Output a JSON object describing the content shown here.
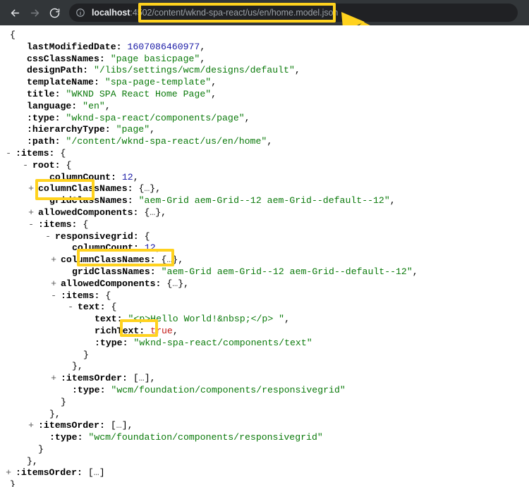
{
  "browser": {
    "back_icon": "back-arrow-icon",
    "forward_icon": "forward-arrow-icon",
    "reload_icon": "reload-icon",
    "site_info_icon": "info-circle-icon",
    "url_host": "localhost",
    "url_port": ":4502",
    "url_path": "/content/wknd-spa-react/us/en/home.model.json",
    "url_full": "localhost:4502/content/wknd-spa-react/us/en/home.model.json",
    "toolbar_bg": "#323639",
    "omnibox_bg": "#202124"
  },
  "annotation": {
    "highlight_color": "#ffd21e",
    "arrow_icon": "pointer-arrow-icon",
    "highlighted_terms": [
      "url-path",
      "root",
      "responsivegrid",
      "text"
    ]
  },
  "json_view": {
    "lines": [
      {
        "indent": 0,
        "toggle": "",
        "segments": [
          {
            "t": "{",
            "c": "pun"
          }
        ]
      },
      {
        "indent": 3,
        "toggle": "",
        "segments": [
          {
            "t": "lastModifiedDate:",
            "c": "k"
          },
          {
            "t": " ",
            "c": "pun"
          },
          {
            "t": "1607086460977",
            "c": "num"
          },
          {
            "t": ",",
            "c": "pun"
          }
        ]
      },
      {
        "indent": 3,
        "toggle": "",
        "segments": [
          {
            "t": "cssClassNames:",
            "c": "k"
          },
          {
            "t": " ",
            "c": "pun"
          },
          {
            "t": "\"page basicpage\"",
            "c": "str"
          },
          {
            "t": ",",
            "c": "pun"
          }
        ]
      },
      {
        "indent": 3,
        "toggle": "",
        "segments": [
          {
            "t": "designPath:",
            "c": "k"
          },
          {
            "t": " ",
            "c": "pun"
          },
          {
            "t": "\"/libs/settings/wcm/designs/default\"",
            "c": "str"
          },
          {
            "t": ",",
            "c": "pun"
          }
        ]
      },
      {
        "indent": 3,
        "toggle": "",
        "segments": [
          {
            "t": "templateName:",
            "c": "k"
          },
          {
            "t": " ",
            "c": "pun"
          },
          {
            "t": "\"spa-page-template\"",
            "c": "str"
          },
          {
            "t": ",",
            "c": "pun"
          }
        ]
      },
      {
        "indent": 3,
        "toggle": "",
        "segments": [
          {
            "t": "title:",
            "c": "k"
          },
          {
            "t": " ",
            "c": "pun"
          },
          {
            "t": "\"WKND SPA React Home Page\"",
            "c": "str"
          },
          {
            "t": ",",
            "c": "pun"
          }
        ]
      },
      {
        "indent": 3,
        "toggle": "",
        "segments": [
          {
            "t": "language:",
            "c": "k"
          },
          {
            "t": " ",
            "c": "pun"
          },
          {
            "t": "\"en\"",
            "c": "str"
          },
          {
            "t": ",",
            "c": "pun"
          }
        ]
      },
      {
        "indent": 3,
        "toggle": "",
        "segments": [
          {
            "t": ":type:",
            "c": "k"
          },
          {
            "t": " ",
            "c": "pun"
          },
          {
            "t": "\"wknd-spa-react/components/page\"",
            "c": "str"
          },
          {
            "t": ",",
            "c": "pun"
          }
        ]
      },
      {
        "indent": 3,
        "toggle": "",
        "segments": [
          {
            "t": ":hierarchyType:",
            "c": "k"
          },
          {
            "t": " ",
            "c": "pun"
          },
          {
            "t": "\"page\"",
            "c": "str"
          },
          {
            "t": ",",
            "c": "pun"
          }
        ]
      },
      {
        "indent": 3,
        "toggle": "",
        "segments": [
          {
            "t": ":path:",
            "c": "k"
          },
          {
            "t": " ",
            "c": "pun"
          },
          {
            "t": "\"/content/wknd-spa-react/us/en/home\"",
            "c": "str"
          },
          {
            "t": ",",
            "c": "pun"
          }
        ]
      },
      {
        "indent": 1,
        "toggle": "-",
        "segments": [
          {
            "t": ":items:",
            "c": "k"
          },
          {
            "t": " {",
            "c": "pun"
          }
        ]
      },
      {
        "indent": 4,
        "toggle": "-",
        "segments": [
          {
            "t": "root:",
            "c": "k"
          },
          {
            "t": " {",
            "c": "pun"
          }
        ]
      },
      {
        "indent": 7,
        "toggle": "",
        "segments": [
          {
            "t": "columnCount:",
            "c": "k"
          },
          {
            "t": " ",
            "c": "pun"
          },
          {
            "t": "12",
            "c": "num"
          },
          {
            "t": ",",
            "c": "pun"
          }
        ]
      },
      {
        "indent": 5,
        "toggle": "+",
        "segments": [
          {
            "t": "columnClassNames:",
            "c": "k"
          },
          {
            "t": " {",
            "c": "pun"
          },
          {
            "t": "…",
            "c": "ell"
          },
          {
            "t": "},",
            "c": "pun"
          }
        ]
      },
      {
        "indent": 7,
        "toggle": "",
        "segments": [
          {
            "t": "gridClassNames:",
            "c": "k"
          },
          {
            "t": " ",
            "c": "pun"
          },
          {
            "t": "\"aem-Grid aem-Grid--12 aem-Grid--default--12\"",
            "c": "str"
          },
          {
            "t": ",",
            "c": "pun"
          }
        ]
      },
      {
        "indent": 5,
        "toggle": "+",
        "segments": [
          {
            "t": "allowedComponents:",
            "c": "k"
          },
          {
            "t": " {",
            "c": "pun"
          },
          {
            "t": "…",
            "c": "ell"
          },
          {
            "t": "},",
            "c": "pun"
          }
        ]
      },
      {
        "indent": 5,
        "toggle": "-",
        "segments": [
          {
            "t": ":items:",
            "c": "k"
          },
          {
            "t": " {",
            "c": "pun"
          }
        ]
      },
      {
        "indent": 8,
        "toggle": "-",
        "segments": [
          {
            "t": "responsivegrid:",
            "c": "k"
          },
          {
            "t": " {",
            "c": "pun"
          }
        ]
      },
      {
        "indent": 11,
        "toggle": "",
        "segments": [
          {
            "t": "columnCount:",
            "c": "k"
          },
          {
            "t": " ",
            "c": "pun"
          },
          {
            "t": "12",
            "c": "num"
          },
          {
            "t": ",",
            "c": "pun"
          }
        ]
      },
      {
        "indent": 9,
        "toggle": "+",
        "segments": [
          {
            "t": "columnClassNames:",
            "c": "k"
          },
          {
            "t": " {",
            "c": "pun"
          },
          {
            "t": "…",
            "c": "ell"
          },
          {
            "t": "},",
            "c": "pun"
          }
        ]
      },
      {
        "indent": 11,
        "toggle": "",
        "segments": [
          {
            "t": "gridClassNames:",
            "c": "k"
          },
          {
            "t": " ",
            "c": "pun"
          },
          {
            "t": "\"aem-Grid aem-Grid--12 aem-Grid--default--12\"",
            "c": "str"
          },
          {
            "t": ",",
            "c": "pun"
          }
        ]
      },
      {
        "indent": 9,
        "toggle": "+",
        "segments": [
          {
            "t": "allowedComponents:",
            "c": "k"
          },
          {
            "t": " {",
            "c": "pun"
          },
          {
            "t": "…",
            "c": "ell"
          },
          {
            "t": "},",
            "c": "pun"
          }
        ]
      },
      {
        "indent": 9,
        "toggle": "-",
        "segments": [
          {
            "t": ":items:",
            "c": "k"
          },
          {
            "t": " {",
            "c": "pun"
          }
        ]
      },
      {
        "indent": 12,
        "toggle": "-",
        "segments": [
          {
            "t": "text:",
            "c": "k"
          },
          {
            "t": " {",
            "c": "pun"
          }
        ]
      },
      {
        "indent": 15,
        "toggle": "",
        "segments": [
          {
            "t": "text:",
            "c": "k"
          },
          {
            "t": " ",
            "c": "pun"
          },
          {
            "t": "\"<p>Hello World!&nbsp;</p> \"",
            "c": "str"
          },
          {
            "t": ",",
            "c": "pun"
          }
        ]
      },
      {
        "indent": 15,
        "toggle": "",
        "segments": [
          {
            "t": "richText:",
            "c": "k"
          },
          {
            "t": " ",
            "c": "pun"
          },
          {
            "t": "true",
            "c": "bool"
          },
          {
            "t": ",",
            "c": "pun"
          }
        ]
      },
      {
        "indent": 15,
        "toggle": "",
        "segments": [
          {
            "t": ":type:",
            "c": "k"
          },
          {
            "t": " ",
            "c": "pun"
          },
          {
            "t": "\"wknd-spa-react/components/text\"",
            "c": "str"
          }
        ]
      },
      {
        "indent": 13,
        "toggle": "",
        "segments": [
          {
            "t": "}",
            "c": "pun"
          }
        ]
      },
      {
        "indent": 11,
        "toggle": "",
        "segments": [
          {
            "t": "},",
            "c": "pun"
          }
        ]
      },
      {
        "indent": 9,
        "toggle": "+",
        "segments": [
          {
            "t": ":itemsOrder:",
            "c": "k"
          },
          {
            "t": " [",
            "c": "pun"
          },
          {
            "t": "…",
            "c": "ell"
          },
          {
            "t": "],",
            "c": "pun"
          }
        ]
      },
      {
        "indent": 11,
        "toggle": "",
        "segments": [
          {
            "t": ":type:",
            "c": "k"
          },
          {
            "t": " ",
            "c": "pun"
          },
          {
            "t": "\"wcm/foundation/components/responsivegrid\"",
            "c": "str"
          }
        ]
      },
      {
        "indent": 9,
        "toggle": "",
        "segments": [
          {
            "t": "}",
            "c": "pun"
          }
        ]
      },
      {
        "indent": 7,
        "toggle": "",
        "segments": [
          {
            "t": "},",
            "c": "pun"
          }
        ]
      },
      {
        "indent": 5,
        "toggle": "+",
        "segments": [
          {
            "t": ":itemsOrder:",
            "c": "k"
          },
          {
            "t": " [",
            "c": "pun"
          },
          {
            "t": "…",
            "c": "ell"
          },
          {
            "t": "],",
            "c": "pun"
          }
        ]
      },
      {
        "indent": 7,
        "toggle": "",
        "segments": [
          {
            "t": ":type:",
            "c": "k"
          },
          {
            "t": " ",
            "c": "pun"
          },
          {
            "t": "\"wcm/foundation/components/responsivegrid\"",
            "c": "str"
          }
        ]
      },
      {
        "indent": 5,
        "toggle": "",
        "segments": [
          {
            "t": "}",
            "c": "pun"
          }
        ]
      },
      {
        "indent": 3,
        "toggle": "",
        "segments": [
          {
            "t": "},",
            "c": "pun"
          }
        ]
      },
      {
        "indent": 1,
        "toggle": "+",
        "segments": [
          {
            "t": ":itemsOrder:",
            "c": "k"
          },
          {
            "t": " [",
            "c": "pun"
          },
          {
            "t": "…",
            "c": "ell"
          },
          {
            "t": "]",
            "c": "pun"
          }
        ]
      },
      {
        "indent": 0,
        "toggle": "",
        "segments": [
          {
            "t": "}",
            "c": "pun"
          }
        ]
      }
    ]
  }
}
